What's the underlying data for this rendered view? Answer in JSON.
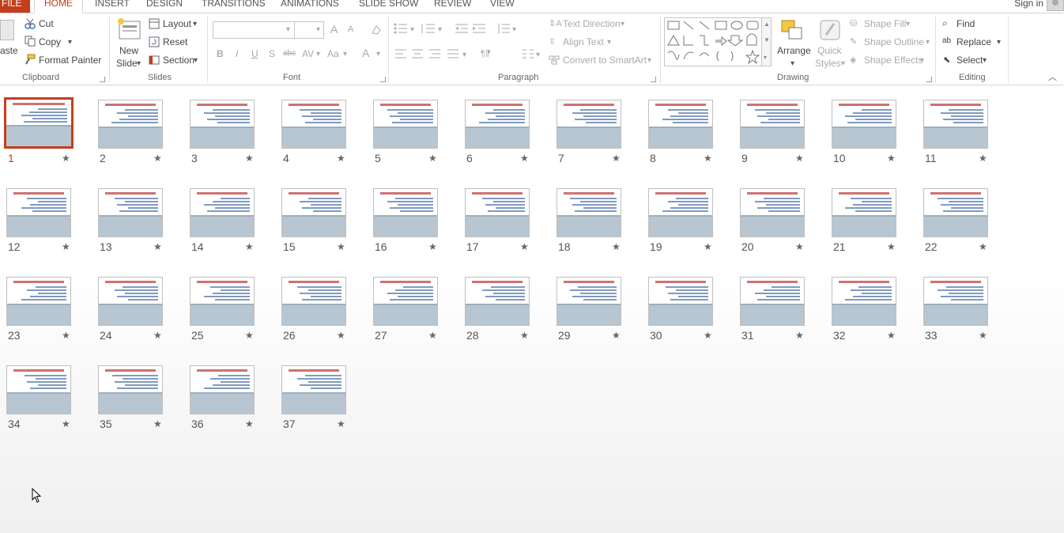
{
  "tabs": {
    "file": "FILE",
    "items": [
      "HOME",
      "INSERT",
      "DESIGN",
      "TRANSITIONS",
      "ANIMATIONS",
      "SLIDE SHOW",
      "REVIEW",
      "VIEW"
    ],
    "active": "HOME",
    "signin": "Sign in"
  },
  "clipboard": {
    "paste": "aste",
    "cut": "Cut",
    "copy": "Copy",
    "format_painter": "Format Painter",
    "label": "Clipboard"
  },
  "slides": {
    "new_slide_1": "New",
    "new_slide_2": "Slide",
    "layout": "Layout",
    "reset": "Reset",
    "section": "Section",
    "label": "Slides"
  },
  "font": {
    "label": "Font",
    "bold": "B",
    "italic": "I",
    "underline": "U",
    "shadow": "S",
    "strike": "abc",
    "spacing": "AV",
    "case": "Aa",
    "color": "A",
    "grow": "A",
    "shrink": "A"
  },
  "paragraph": {
    "text_direction": "Text Direction",
    "align_text": "Align Text",
    "convert_smartart": "Convert to SmartArt",
    "label": "Paragraph"
  },
  "drawing": {
    "arrange": "Arrange",
    "quick_styles_1": "Quick",
    "quick_styles_2": "Styles",
    "shape_fill": "Shape Fill",
    "shape_outline": "Shape Outline",
    "shape_effects": "Shape Effects",
    "label": "Drawing"
  },
  "editing": {
    "find": "Find",
    "replace": "Replace",
    "select": "Select",
    "label": "Editing"
  },
  "slide_list": [
    "1",
    "2",
    "3",
    "4",
    "5",
    "6",
    "7",
    "8",
    "9",
    "10",
    "11",
    "12",
    "13",
    "14",
    "15",
    "16",
    "17",
    "18",
    "19",
    "20",
    "21",
    "22",
    "23",
    "24",
    "25",
    "26",
    "27",
    "28",
    "29",
    "30",
    "31",
    "32",
    "33",
    "34",
    "35",
    "36",
    "37"
  ],
  "selected_slide": "1",
  "accent": "#c43e1c"
}
